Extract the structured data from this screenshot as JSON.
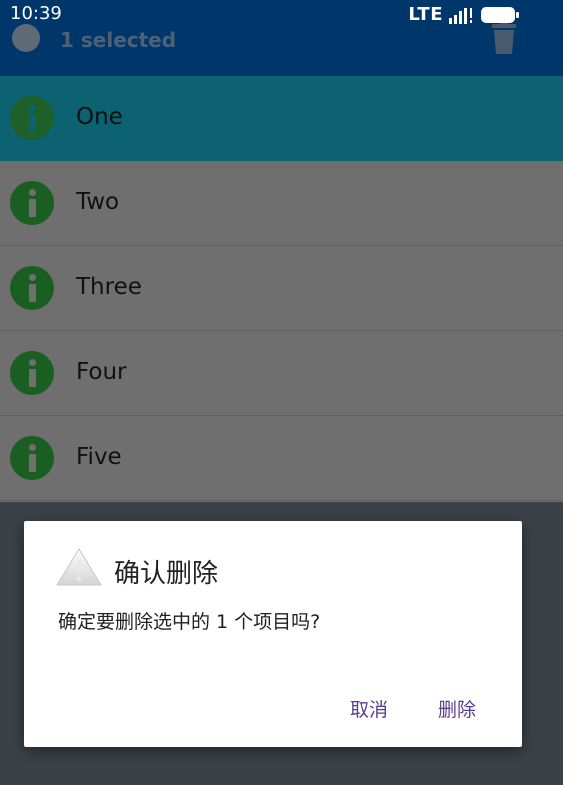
{
  "status_bar": {
    "time": "10:39",
    "network": "LTE"
  },
  "app_bar": {
    "selected_text": "1 selected"
  },
  "list": {
    "items": [
      {
        "label": "One",
        "selected": true
      },
      {
        "label": "Two",
        "selected": false
      },
      {
        "label": "Three",
        "selected": false
      },
      {
        "label": "Four",
        "selected": false
      },
      {
        "label": "Five",
        "selected": false
      }
    ]
  },
  "dialog": {
    "title": "确认删除",
    "message": "确定要删除选中的 1 个项目吗?",
    "cancel_label": "取消",
    "delete_label": "删除"
  },
  "icons": {
    "item": "info-icon",
    "app_bar_left": "check-circle-icon",
    "app_bar_right": "trash-icon",
    "dialog": "warning-icon"
  },
  "colors": {
    "app_bar": "#00376b",
    "selected_row": "#0c6270",
    "item_icon": "#1b5e22",
    "dialog_button": "#5b3d92"
  }
}
